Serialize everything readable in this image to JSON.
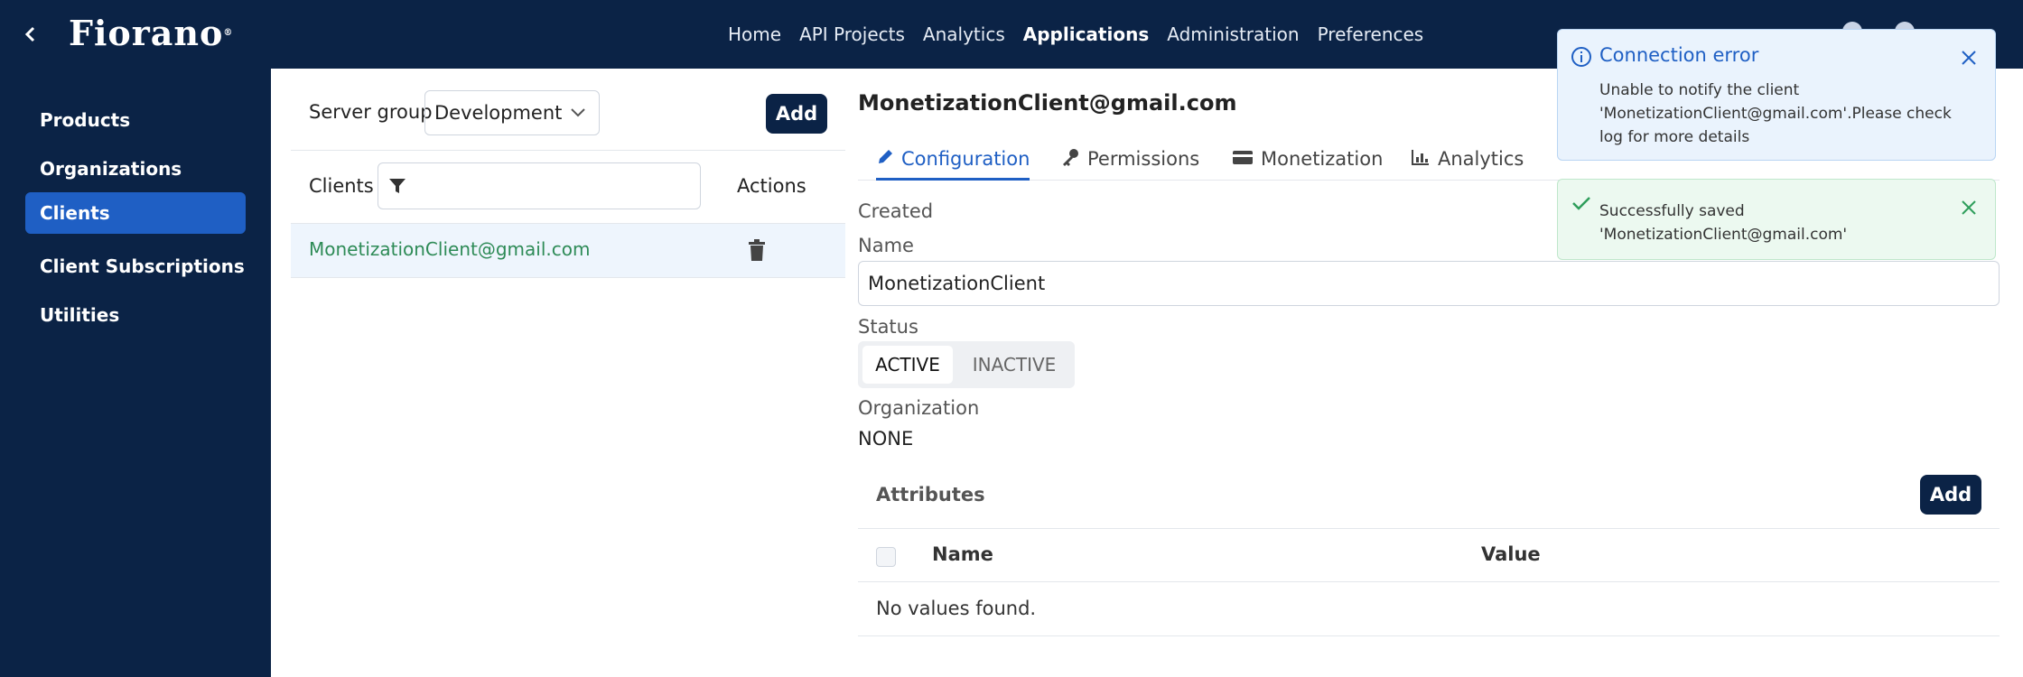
{
  "header": {
    "logo_text": "Fiorano",
    "logo_mark": "®",
    "back_icon": "chevron-left-icon",
    "nav": [
      {
        "label": "Home"
      },
      {
        "label": "API Projects"
      },
      {
        "label": "Analytics"
      },
      {
        "label": "Applications"
      },
      {
        "label": "Administration"
      },
      {
        "label": "Preferences"
      }
    ]
  },
  "sidebar": {
    "items": [
      {
        "label": "Products"
      },
      {
        "label": "Organizations"
      },
      {
        "label": "Clients"
      },
      {
        "label": "Client Subscriptions"
      },
      {
        "label": "Utilities"
      }
    ]
  },
  "clients_panel": {
    "server_group_label": "Server group",
    "server_group_value": "Development",
    "add_label": "Add",
    "clients_label": "Clients",
    "actions_label": "Actions",
    "rows": [
      {
        "email": "MonetizationClient@gmail.com"
      }
    ]
  },
  "detail": {
    "title": "MonetizationClient@gmail.com",
    "tabs": [
      {
        "label": "Configuration",
        "icon": "pencil-icon"
      },
      {
        "label": "Permissions",
        "icon": "key-icon"
      },
      {
        "label": "Monetization",
        "icon": "credit-card-icon"
      },
      {
        "label": "Analytics",
        "icon": "bar-chart-icon"
      }
    ],
    "created_label": "Created",
    "name_label": "Name",
    "name_value": "MonetizationClient",
    "status_label": "Status",
    "status_active": "ACTIVE",
    "status_inactive": "INACTIVE",
    "organization_label": "Organization",
    "organization_value": "NONE",
    "attributes_title": "Attributes",
    "attributes_add": "Add",
    "col_name": "Name",
    "col_value": "Value",
    "empty": "No values found."
  },
  "toasts": {
    "error": {
      "title": "Connection error",
      "message": "Unable to notify the client\n'MonetizationClient@gmail.com'.Please check\nlog for more details"
    },
    "success": {
      "message": "Successfully saved\n'MonetizationClient@gmail.com'"
    }
  },
  "colors": {
    "navy": "#0b2346",
    "accent": "#1f5fc4",
    "success_text": "#2e8b57"
  }
}
